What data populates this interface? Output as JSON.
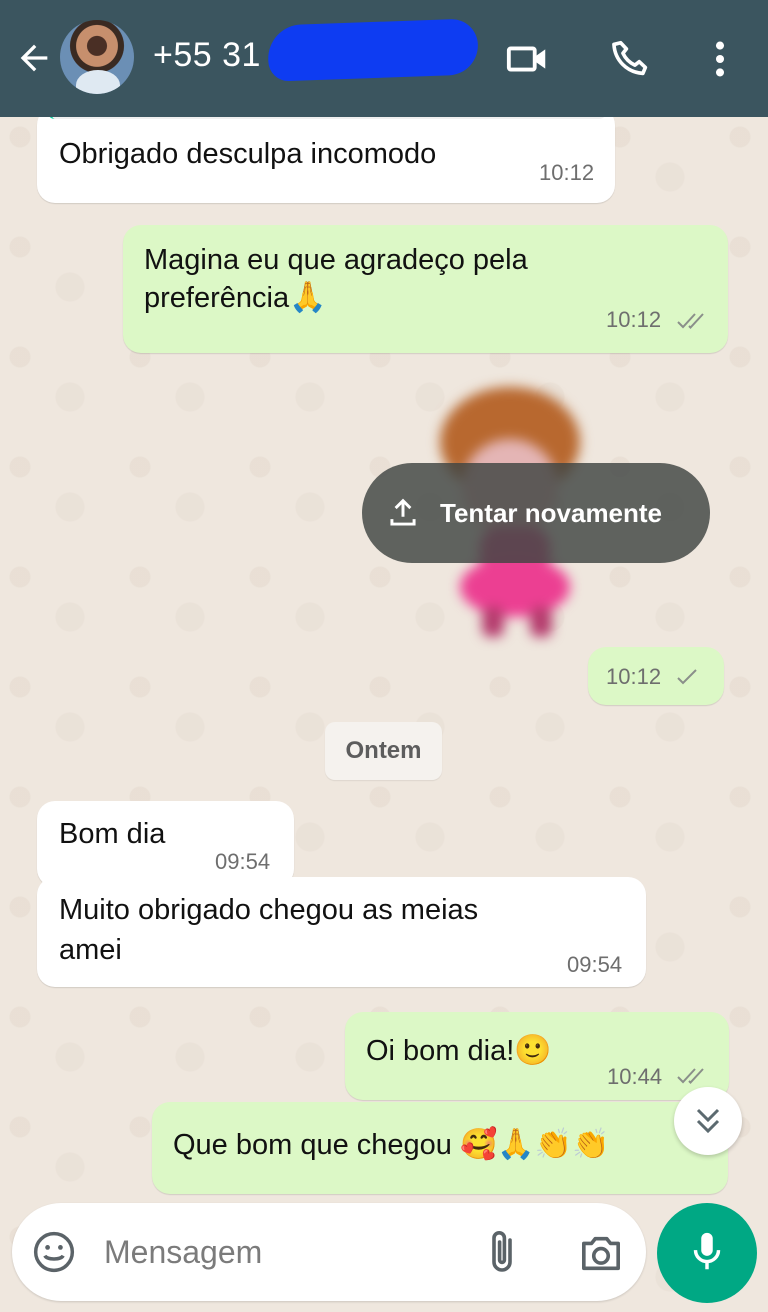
{
  "header": {
    "contact_name": "+55 31",
    "accent_color": "#3b555f",
    "icons": [
      "arrow-back-icon",
      "video-icon",
      "phone-icon",
      "more-vert-icon"
    ]
  },
  "messages": [
    {
      "direction": "in",
      "text": "Obrigado desculpa incomodo",
      "time": "10:12"
    },
    {
      "direction": "out",
      "text_line1": "Magina eu que agradeço pela",
      "text_line2": "preferência",
      "emoji": "🙏",
      "time": "10:12",
      "status": "read"
    },
    {
      "direction": "out",
      "type": "sticker",
      "action_label": "Tentar novamente",
      "time": "10:12",
      "status": "sent"
    },
    {
      "direction": "in",
      "text": "Bom dia",
      "time": "09:54"
    },
    {
      "direction": "in",
      "text_line1": "Muito obrigado chegou as meias",
      "text_line2": "amei",
      "time": "09:54"
    },
    {
      "direction": "out",
      "text": "Oi bom dia!",
      "emoji": "🙂",
      "time": "10:44",
      "status": "read"
    },
    {
      "direction": "out",
      "text": "Que bom que chegou",
      "emoji": "🥰🙏👏👏"
    }
  ],
  "date_separator": "Ontem",
  "composer": {
    "placeholder": "Mensagem",
    "send_color": "#00a884"
  }
}
